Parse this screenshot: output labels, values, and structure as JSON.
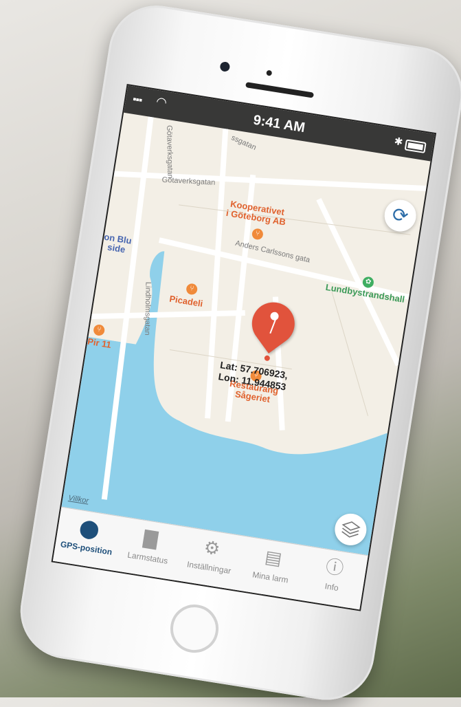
{
  "status_bar": {
    "time": "9:41 AM",
    "signal": "▪▪▪",
    "wifi": "📶",
    "bluetooth": "✱"
  },
  "map": {
    "streets": [
      "Götaverksgatan",
      "Götaverksgatan",
      "Anders Carlssons gata",
      "Lindholmsgatan",
      "ssgatan"
    ],
    "places": [
      {
        "name": "Kooperativet\ni Göteborg AB",
        "kind": "restaurant"
      },
      {
        "name": "Lundbystrandshall",
        "kind": "park"
      },
      {
        "name": "Picadeli",
        "kind": "restaurant"
      },
      {
        "name": "Restaurang\nSågeriet",
        "kind": "restaurant"
      },
      {
        "name": "Pir 11",
        "kind": "restaurant"
      },
      {
        "name": "on Blu\nside",
        "kind": "place"
      }
    ],
    "pin": {
      "lat_label": "Lat: 57.706923,",
      "lon_label": "Lon: 11.944853"
    },
    "legal_link": "Villkor",
    "refresh_icon": "refresh-icon",
    "layers_icon": "layers-icon"
  },
  "tabbar": {
    "tabs": [
      {
        "label": "GPS-position",
        "icon": "location-pin-icon",
        "active": true
      },
      {
        "label": "Larmstatus",
        "icon": "bar-chart-icon",
        "active": false
      },
      {
        "label": "Inställningar",
        "icon": "gear-icon",
        "active": false
      },
      {
        "label": "Mina larm",
        "icon": "document-icon",
        "active": false
      },
      {
        "label": "Info",
        "icon": "info-icon",
        "active": false
      }
    ]
  },
  "colors": {
    "accent": "#1e4f7a",
    "pin": "#e1533c",
    "water": "#8fd0ea",
    "land": "#f3efe6"
  }
}
